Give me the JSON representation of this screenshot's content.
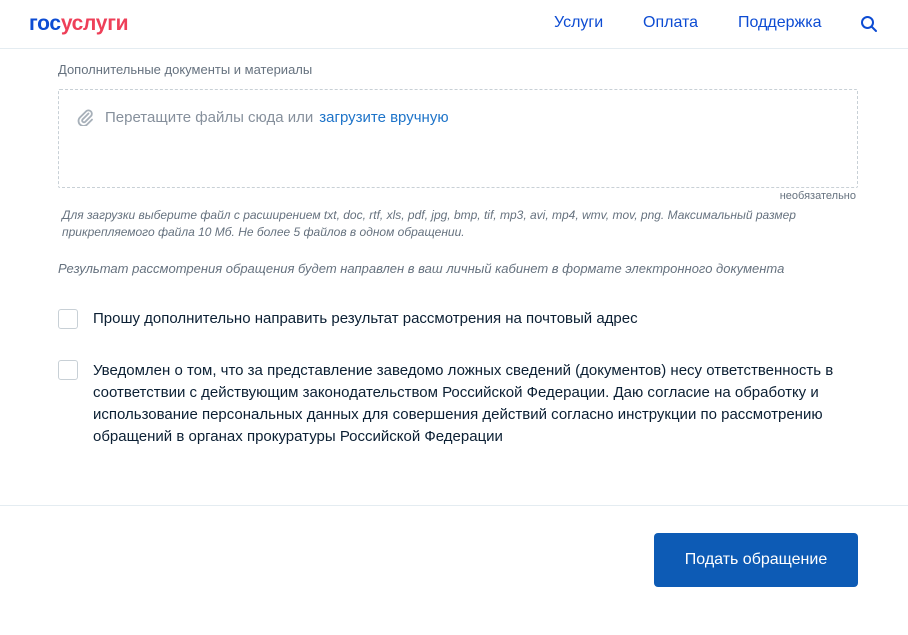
{
  "header": {
    "logo_part1": "гос",
    "logo_part2": "услуги",
    "nav": [
      "Услуги",
      "Оплата",
      "Поддержка"
    ]
  },
  "upload": {
    "label": "Дополнительные документы и материалы",
    "drop_text": "Перетащите файлы сюда или",
    "drop_link": "загрузите вручную",
    "optional": "необязательно",
    "hint": "Для загрузки выберите файл с расширением txt, doc, rtf, xls, pdf, jpg, bmp, tif, mp3, avi, mp4, wmv, mov, png. Максимальный размер прикрепляемого файла 10 Мб. Не более 5 файлов в одном обращении."
  },
  "result_note": "Результат рассмотрения обращения будет направлен в ваш личный кабинет в формате электронного документа",
  "checkboxes": [
    {
      "label": "Прошу дополнительно направить результат рассмотрения на почтовый адрес",
      "checked": false
    },
    {
      "label": "Уведомлен о том, что за представление заведомо ложных сведений (документов) несу ответственность в соответствии с действующим законодательством Российской Федерации. Даю согласие на обработку и использование персональных данных для совершения действий согласно инструкции по рассмотрению обращений в органах прокуратуры Российской Федерации",
      "checked": false
    }
  ],
  "submit_label": "Подать обращение",
  "icons": {
    "search": "search-icon",
    "attach": "paperclip-icon"
  },
  "colors": {
    "brand_blue": "#0d4cd3",
    "brand_red": "#ee3f58",
    "button": "#0d5bb5"
  }
}
